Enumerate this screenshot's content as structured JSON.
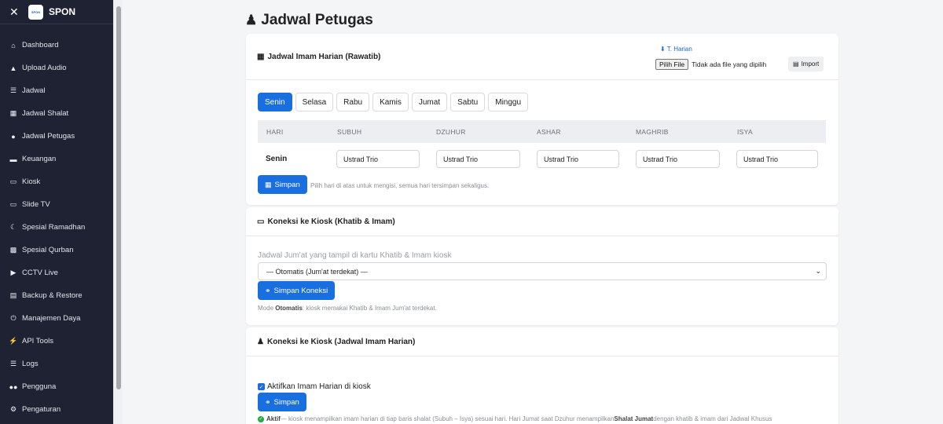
{
  "sidebar": {
    "close_icon": "✕",
    "logo_text": "SPON",
    "brand": "SPON",
    "items": [
      {
        "label": "Dashboard",
        "icon": "home-icon"
      },
      {
        "label": "Upload Audio",
        "icon": "upload-icon"
      },
      {
        "label": "Jadwal",
        "icon": "list-icon"
      },
      {
        "label": "Jadwal Shalat",
        "icon": "calendar-icon"
      },
      {
        "label": "Jadwal Petugas",
        "icon": "user-icon"
      },
      {
        "label": "Keuangan",
        "icon": "wallet-icon"
      },
      {
        "label": "Kiosk",
        "icon": "monitor-icon"
      },
      {
        "label": "Slide TV",
        "icon": "tv-icon"
      },
      {
        "label": "Spesial Ramadhan",
        "icon": "moon-icon"
      },
      {
        "label": "Spesial Qurban",
        "icon": "animal-icon"
      },
      {
        "label": "CCTV Live",
        "icon": "video-icon"
      },
      {
        "label": "Backup & Restore",
        "icon": "archive-icon"
      },
      {
        "label": "Manajemen Daya",
        "icon": "power-icon"
      },
      {
        "label": "API Tools",
        "icon": "bolt-icon"
      },
      {
        "label": "Logs",
        "icon": "logs-icon"
      },
      {
        "label": "Pengguna",
        "icon": "users-icon"
      },
      {
        "label": "Pengaturan",
        "icon": "gear-icon"
      }
    ]
  },
  "page": {
    "title": "Jadwal Petugas"
  },
  "imam_card": {
    "title": "Jadwal Imam Harian (Rawatib)",
    "template_link": "T. Harian",
    "file_button": "Pilih File",
    "file_status": "Tidak ada file yang dipilih",
    "import_button": "Import",
    "tabs": [
      "Senin",
      "Selasa",
      "Rabu",
      "Kamis",
      "Jumat",
      "Sabtu",
      "Minggu"
    ],
    "active_tab": "Senin",
    "columns": [
      "HARI",
      "SUBUH",
      "DZUHUR",
      "ASHAR",
      "MAGHRIB",
      "ISYA"
    ],
    "row": {
      "day": "Senin",
      "values": [
        "Ustrad Trio",
        "Ustrad Trio",
        "Ustrad Trio",
        "Ustrad Trio",
        "Ustrad Trio"
      ]
    },
    "save_button": "Simpan",
    "hint": "Pilih hari di atas untuk mengisi, semua hari tersimpan sekaligus."
  },
  "kiosk_card": {
    "title": "Koneksi ke Kiosk (Khatib & Imam)",
    "label": "Jadwal Jum'at yang tampil di kartu Khatib & Imam kiosk",
    "select_value": "— Otomatis (Jum'at terdekat) —",
    "save_button": "Simpan Koneksi",
    "note_prefix": "Mode ",
    "note_bold": "Otomatis",
    "note_suffix": ": kiosk memakai Khatib & Imam Jum'at terdekat."
  },
  "daily_card": {
    "title": "Koneksi ke Kiosk (Jadwal Imam Harian)",
    "checkbox_label": "Aktifkan Imam Harian di kiosk",
    "save_button": "Simpan",
    "note_bold": "Aktif",
    "note_text": " — kiosk menampilkan imam harian di tiap baris shalat (Subuh – Isya) sesuai hari. Hari Jumat saat Dzuhur menampilkan ",
    "note_bold2": "Shalat Jumat",
    "note_text2": " dengan khatib & imam dari Jadwal Khusus"
  },
  "colors": {
    "sidebar_bg": "#1f2233",
    "primary": "#1a6fe0",
    "success": "#27a844"
  }
}
